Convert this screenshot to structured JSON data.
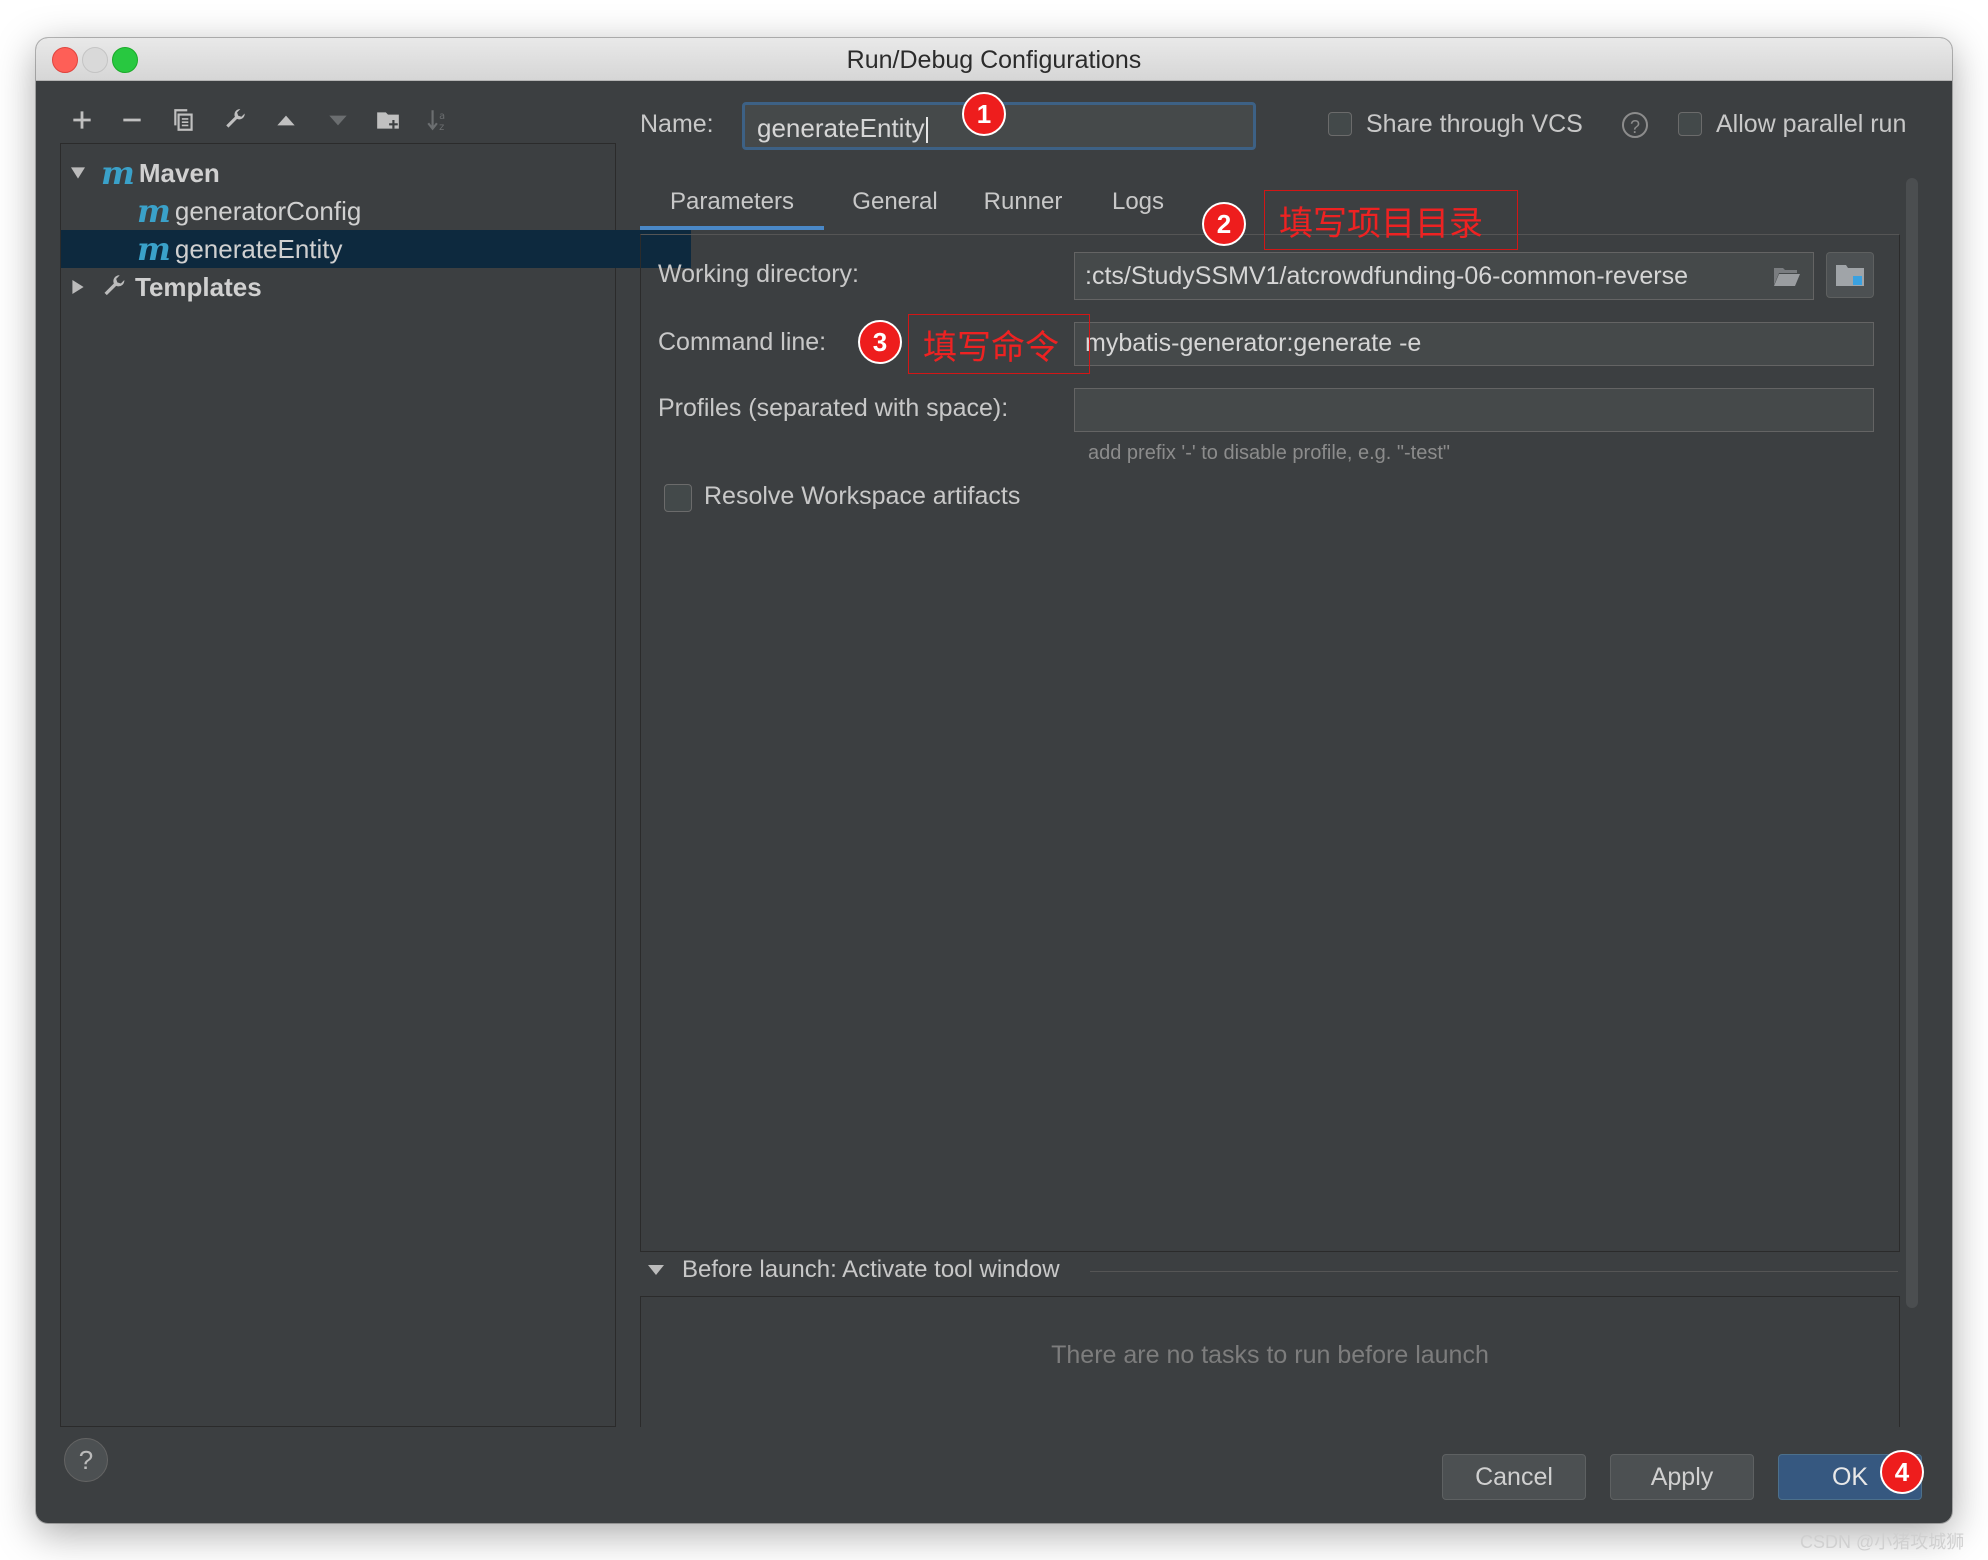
{
  "window": {
    "title": "Run/Debug Configurations"
  },
  "toolbar": {
    "icons": [
      "add-icon",
      "remove-icon",
      "copy-icon",
      "wrench-icon",
      "move-up-icon",
      "move-down-icon",
      "folder-add-icon",
      "sort-icon"
    ]
  },
  "tree": {
    "maven_label": "Maven",
    "items": [
      {
        "label": "generatorConfig",
        "icon": "maven-m-icon"
      },
      {
        "label": "generateEntity",
        "icon": "maven-m-icon",
        "selected": true
      }
    ],
    "templates_label": "Templates"
  },
  "name_field": {
    "label": "Name:",
    "value": "generateEntity"
  },
  "share_vcs": {
    "label": "Share through VCS",
    "checked": false
  },
  "allow_parallel": {
    "label": "Allow parallel run",
    "checked": false
  },
  "tabs": [
    "Parameters",
    "General",
    "Runner",
    "Logs"
  ],
  "active_tab": "Parameters",
  "params": {
    "working_dir_label": "Working directory:",
    "working_dir_value": ":cts/StudySSMV1/atcrowdfunding-06-common-reverse",
    "command_line_label": "Command line:",
    "command_line_value": "mybatis-generator:generate -e",
    "profiles_label": "Profiles (separated with space):",
    "profiles_value": "",
    "profiles_hint": "add prefix '-' to disable profile, e.g. \"-test\"",
    "resolve_label": "Resolve Workspace artifacts",
    "resolve_checked": false
  },
  "before_launch": {
    "label": "Before launch: Activate tool window",
    "empty_text": "There are no tasks to run before launch"
  },
  "buttons": {
    "help": "?",
    "cancel": "Cancel",
    "apply": "Apply",
    "ok": "OK"
  },
  "annotations": {
    "badge1": "1",
    "badge2": "2",
    "note2": "填写项目目录",
    "badge3": "3",
    "note3": "填写命令",
    "badge4": "4"
  },
  "watermark": "CSDN @小猪攻城狮",
  "colors": {
    "accent": "#365880",
    "selection": "#0d293e",
    "annotation": "#ee1d1d"
  }
}
